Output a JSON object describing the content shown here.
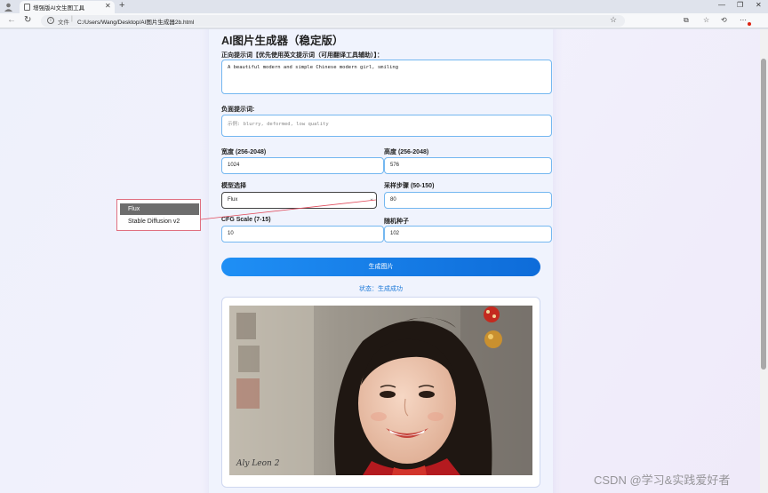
{
  "browser": {
    "tab_title": "增强版AI文生图工具",
    "address_label": "文件",
    "url": "C:/Users/Wang/Desktop/AI图片生成器2b.html"
  },
  "page": {
    "title": "AI图片生成器（稳定版）",
    "prompt_label": "正向提示词【优先使用英文提示词（可用翻译工具辅助）】：",
    "prompt_value": "A beautiful modern and simple Chinese modern girl, smiling",
    "negative_label": "负面提示词:",
    "negative_placeholder": "示例: blurry, deformed, low quality",
    "width_label": "宽度 (256-2048)",
    "width_value": "1024",
    "height_label": "高度 (256-2048)",
    "height_value": "576",
    "model_label": "模型选择",
    "model_value": "Flux",
    "steps_label": "采样步骤 (50-150)",
    "steps_value": "80",
    "cfg_label": "CFG Scale (7-15)",
    "cfg_value": "10",
    "seed_label": "随机种子",
    "seed_value": "102",
    "generate_label": "生成图片",
    "status_text": "状态：生成成功"
  },
  "dropdown": {
    "options": [
      "Flux",
      "Stable Diffusion v2"
    ],
    "selected": "Flux"
  },
  "photo": {
    "signature": "Aly Leon 2"
  },
  "watermark": "CSDN @学习&实践爱好者",
  "colors": {
    "accent": "#1a78d8",
    "field_border": "#74b7f0",
    "button_start": "#1f8ff5",
    "button_end": "#0e6cd9"
  },
  "icons": [
    "profile-icon",
    "file-icon",
    "close-icon",
    "plus-icon",
    "back-icon",
    "reload-icon",
    "info-icon",
    "star-icon",
    "extensions-icon",
    "favorites-icon",
    "history-icon",
    "more-icon"
  ]
}
